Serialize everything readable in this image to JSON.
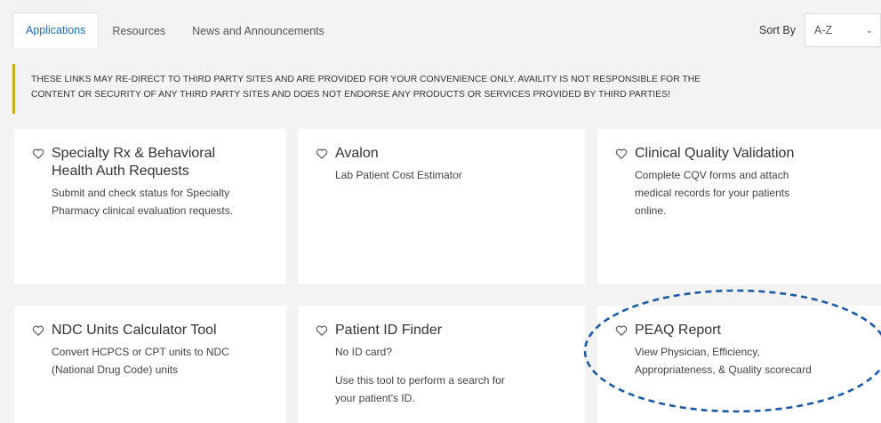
{
  "tabs": [
    {
      "label": "Applications",
      "active": true
    },
    {
      "label": "Resources",
      "active": false
    },
    {
      "label": "News and Announcements",
      "active": false
    }
  ],
  "sort": {
    "label": "Sort By",
    "value": "A-Z"
  },
  "notice": {
    "line1": "THESE LINKS MAY RE-DIRECT TO THIRD PARTY SITES AND ARE PROVIDED FOR YOUR CONVENIENCE ONLY. AVAILITY IS NOT RESPONSIBLE FOR THE",
    "line2": "CONTENT OR SECURITY OF ANY THIRD PARTY SITES AND DOES NOT ENDORSE ANY PRODUCTS OR SERVICES PROVIDED BY THIRD PARTIES!"
  },
  "cards": [
    {
      "title_line1": "Specialty Rx & Behavioral",
      "title_line2": "Health Auth Requests",
      "desc1": "Submit and check status for Specialty",
      "desc2": "Pharmacy clinical evaluation requests."
    },
    {
      "title": "Avalon",
      "desc1": "Lab Patient Cost Estimator"
    },
    {
      "title": "Clinical Quality Validation",
      "desc1": "Complete CQV forms and attach",
      "desc2": "medical records for your patients",
      "desc3": "online."
    },
    {
      "title": "NDC Units Calculator Tool",
      "desc1": "Convert HCPCS or CPT units to NDC",
      "desc2": "(National Drug Code) units"
    },
    {
      "title": "Patient ID Finder",
      "desc1": "No ID card?",
      "desc2": "Use this tool to perform a search for",
      "desc3": "your patient's ID."
    },
    {
      "title": "PEAQ Report",
      "desc1": "View Physician, Efficiency,",
      "desc2": "Appropriateness, & Quality scorecard"
    }
  ],
  "icons": {
    "favorite": "heart-outline-icon",
    "dropdown": "chevron-down-icon"
  },
  "colors": {
    "tab_active": "#1f6fb5",
    "notice_border": "#d2a726",
    "annotation": "#1a5aa8"
  }
}
